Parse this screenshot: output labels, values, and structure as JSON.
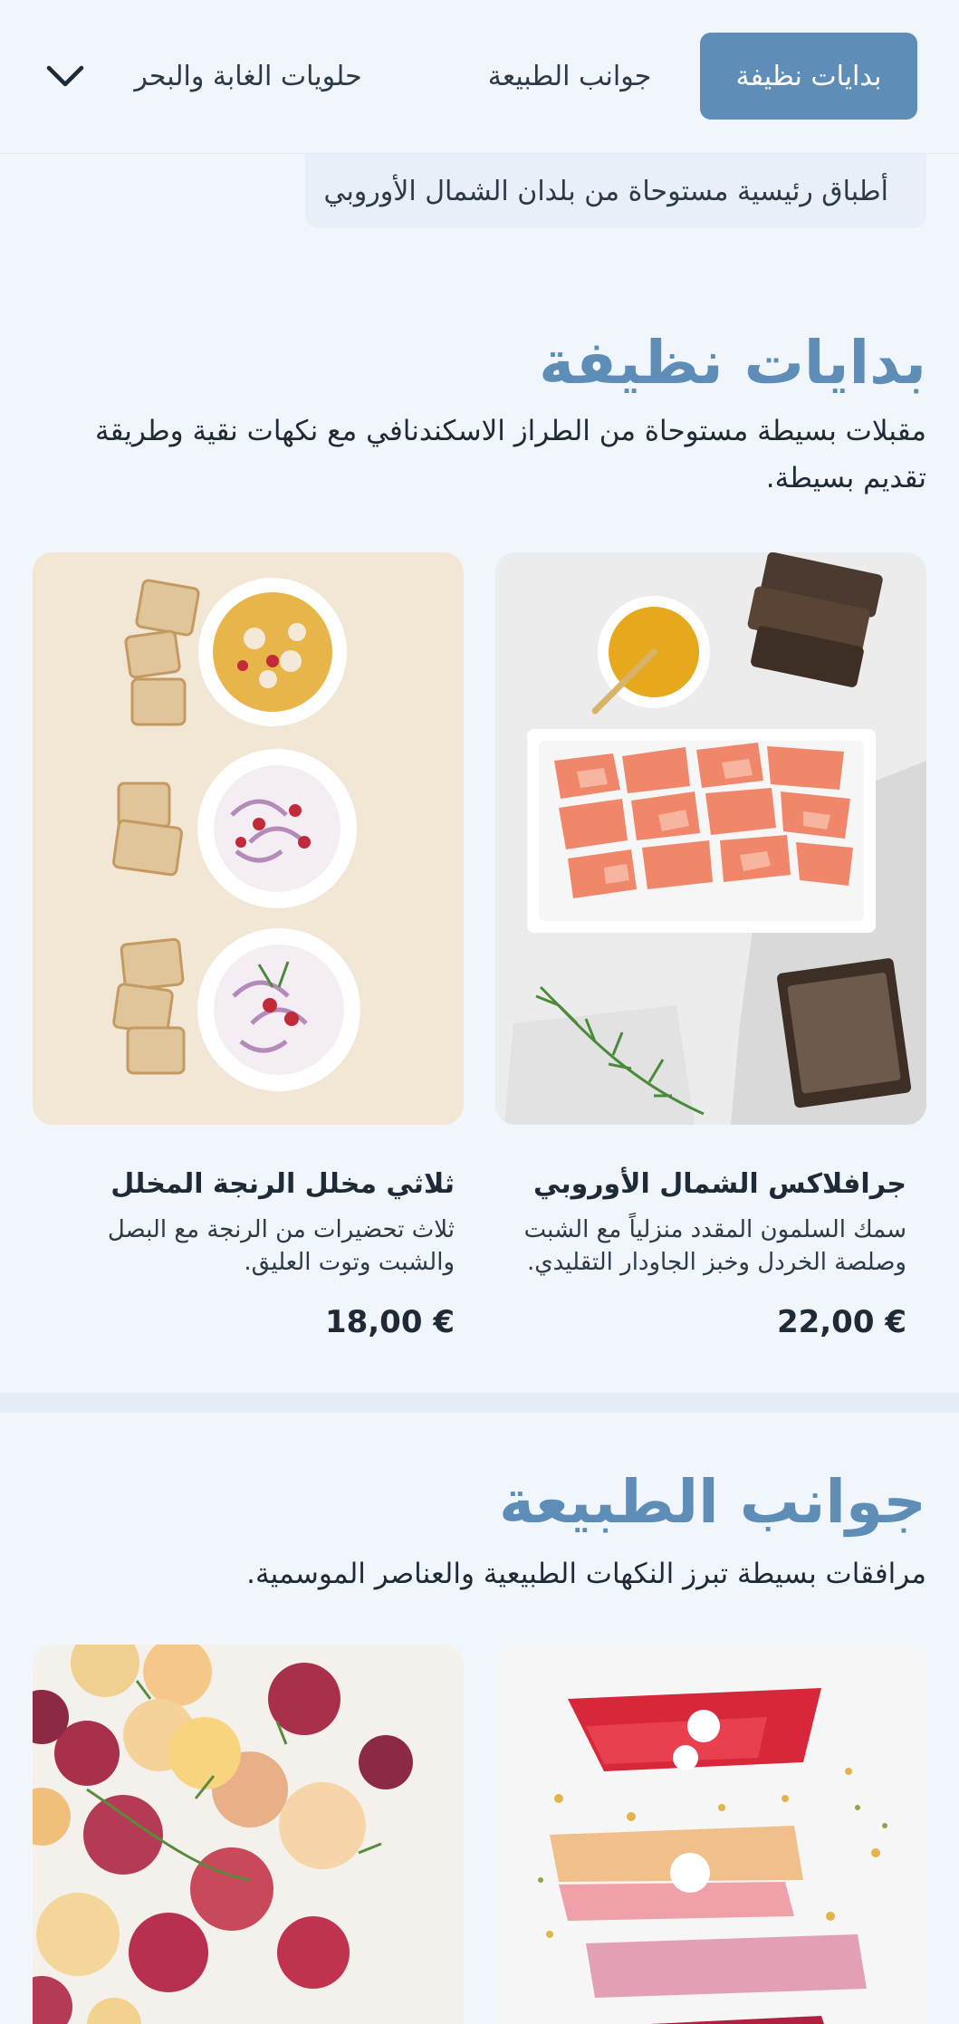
{
  "nav": {
    "tabs": [
      {
        "label": "بدايات نظيفة",
        "active": true
      },
      {
        "label": "جوانب الطبيعة",
        "active": false
      },
      {
        "label": "حلويات الغابة والبحر",
        "active": false
      }
    ],
    "more_icon": "chevron-down-icon",
    "sub_item": "أطباق رئيسية مستوحاة من بلدان الشمال الأوروبي"
  },
  "sections": [
    {
      "title": "بدايات نظيفة",
      "description": "مقبلات بسيطة مستوحاة من الطراز الاسكندنافي مع نكهات نقية وطريقة تقديم بسيطة.",
      "items": [
        {
          "name": "جرافلاكس الشمال الأوروبي",
          "description": "سمك السلمون المقدد منزلياً مع الشبت وصلصة الخردل وخبز الجاودار التقليدي.",
          "price": "22,00 €"
        },
        {
          "name": "ثلاثي مخلل الرنجة المخلل",
          "description": "ثلاث تحضيرات من الرنجة مع البصل والشبت وتوت العليق.",
          "price": "18,00 €"
        }
      ]
    },
    {
      "title": "جوانب الطبيعة",
      "description": "مرافقات بسيطة تبرز النكهات الطبيعية والعناصر الموسمية."
    }
  ],
  "colors": {
    "accent": "#5e8db7",
    "background": "#f1f6fc",
    "text": "#1e2a36"
  }
}
